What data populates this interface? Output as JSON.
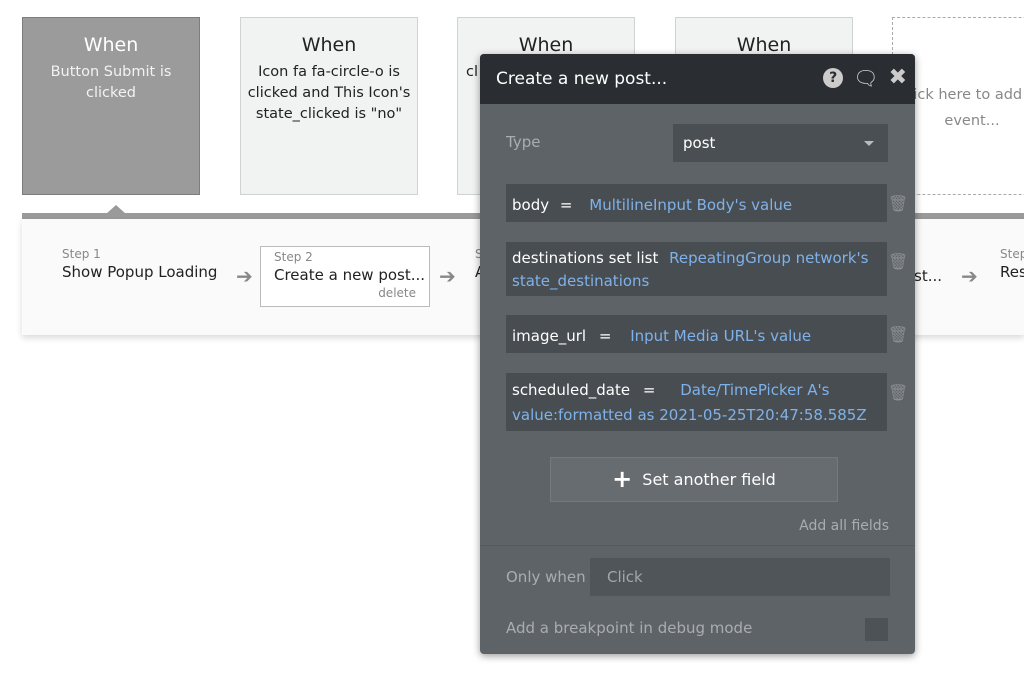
{
  "events": [
    {
      "title": "When",
      "desc": "Button Submit is clicked",
      "selected": true
    },
    {
      "title": "When",
      "desc": "Icon fa fa-circle-o is clicked and This Icon's state_clicked is \"no\""
    },
    {
      "title": "When",
      "desc": "cl s"
    },
    {
      "title": "When",
      "desc": ""
    }
  ],
  "add_event": "Click here to add an event...",
  "steps": [
    {
      "label": "Step 1",
      "name": "Show Popup Loading"
    },
    {
      "label": "Step 2",
      "name": "Create a new post...",
      "delete": "delete"
    },
    {
      "label": "S",
      "name": "A"
    },
    {
      "name": "st..."
    },
    {
      "label": "Step",
      "name": "Res"
    }
  ],
  "popup": {
    "title": "Create a new post...",
    "icons": [
      "help-icon",
      "comment-icon",
      "close-icon"
    ],
    "type_label": "Type",
    "type_value": "post",
    "fields": [
      {
        "key": "body",
        "op": "=",
        "value": "MultilineInput Body's value"
      },
      {
        "key": "destinations",
        "op": "set list",
        "value": "RepeatingGroup network's state_destinations"
      },
      {
        "key": "image_url",
        "op": "=",
        "value": "Input Media URL's value"
      },
      {
        "key": "scheduled_date",
        "op": "=",
        "value": "Date/TimePicker A's value:formatted as 2021-05-25T20:47:58.585Z"
      }
    ],
    "set_another": "Set another field",
    "add_all": "Add all fields",
    "only_when_label": "Only when",
    "only_when_placeholder": "Click",
    "breakpoint_label": "Add a breakpoint in debug mode",
    "breakpoint_checked": false,
    "link_color": "#7fb2ea"
  }
}
